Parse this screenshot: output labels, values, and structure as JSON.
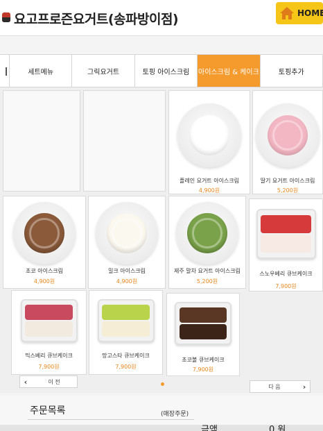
{
  "header": {
    "store_title": "요고프로즌요거트(송파방이점)",
    "home_label": "HOME",
    "colors": {
      "home_button": "#f5c518",
      "logo": "#c0392b"
    }
  },
  "tabs": [
    {
      "label": "세트메뉴",
      "active": false
    },
    {
      "label": "그릭요거트",
      "active": false
    },
    {
      "label": "토핑 아이스크림",
      "active": false
    },
    {
      "label": "아이스크림 & 케이크",
      "active": true
    },
    {
      "label": "토핑추가",
      "active": false
    }
  ],
  "accent_color": "#f59a2c",
  "price_color": "#e8861a",
  "products": [
    {
      "name": "플레인 요거트 아이스크림",
      "price": "4,900원",
      "kind": "icecream",
      "color": "#ffffff"
    },
    {
      "name": "딸기 요거트 아이스크림",
      "price": "5,200원",
      "kind": "icecream",
      "color": "#f3b7c3"
    },
    {
      "name": "초코 아이스크림",
      "price": "4,900원",
      "kind": "icecream",
      "color": "#8a5a3a"
    },
    {
      "name": "밀크 아이스크림",
      "price": "4,900원",
      "kind": "icecream",
      "color": "#fbf8f0"
    },
    {
      "name": "제주 말차 요거트 아이스크림",
      "price": "5,200원",
      "kind": "icecream",
      "color": "#7aa24a"
    },
    {
      "name": "스노우베리 큐브케이크",
      "price": "7,900원",
      "kind": "cake",
      "color": "#d63a3a"
    },
    {
      "name": "믹스베리 큐브케이크",
      "price": "7,900원",
      "kind": "cake",
      "color": "#c94a5e"
    },
    {
      "name": "망고스타 큐브케이크",
      "price": "7,900원",
      "kind": "cake",
      "color": "#b9d44a"
    },
    {
      "name": "초코볼 큐브케이크",
      "price": "7,900원",
      "kind": "cake",
      "color": "#5a3624"
    }
  ],
  "pager": {
    "prev_label": "이 전",
    "next_label": "다 음"
  },
  "order": {
    "title": "주문목록",
    "mode": "(매장주문)",
    "total_label": "금액",
    "total_value": "0 원"
  }
}
